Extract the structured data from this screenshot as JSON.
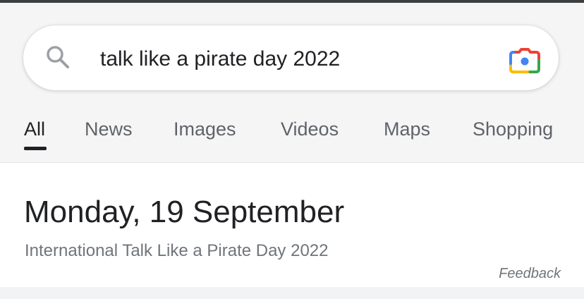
{
  "search": {
    "query": "talk like a pirate day 2022",
    "search_icon": "magnifier-icon",
    "lens_icon": "google-lens-camera-icon"
  },
  "tabs": [
    {
      "label": "All",
      "active": true
    },
    {
      "label": "News",
      "active": false
    },
    {
      "label": "Images",
      "active": false
    },
    {
      "label": "Videos",
      "active": false
    },
    {
      "label": "Maps",
      "active": false
    },
    {
      "label": "Shopping",
      "active": false
    }
  ],
  "answer": {
    "date": "Monday, 19 September",
    "description": "International Talk Like a Pirate Day 2022",
    "feedback_label": "Feedback"
  },
  "colors": {
    "lens_blue": "#4285f4",
    "lens_red": "#ea4335",
    "lens_yellow": "#fbbc04",
    "lens_green": "#34a853",
    "text_primary": "#202124",
    "text_secondary": "#70757a"
  }
}
